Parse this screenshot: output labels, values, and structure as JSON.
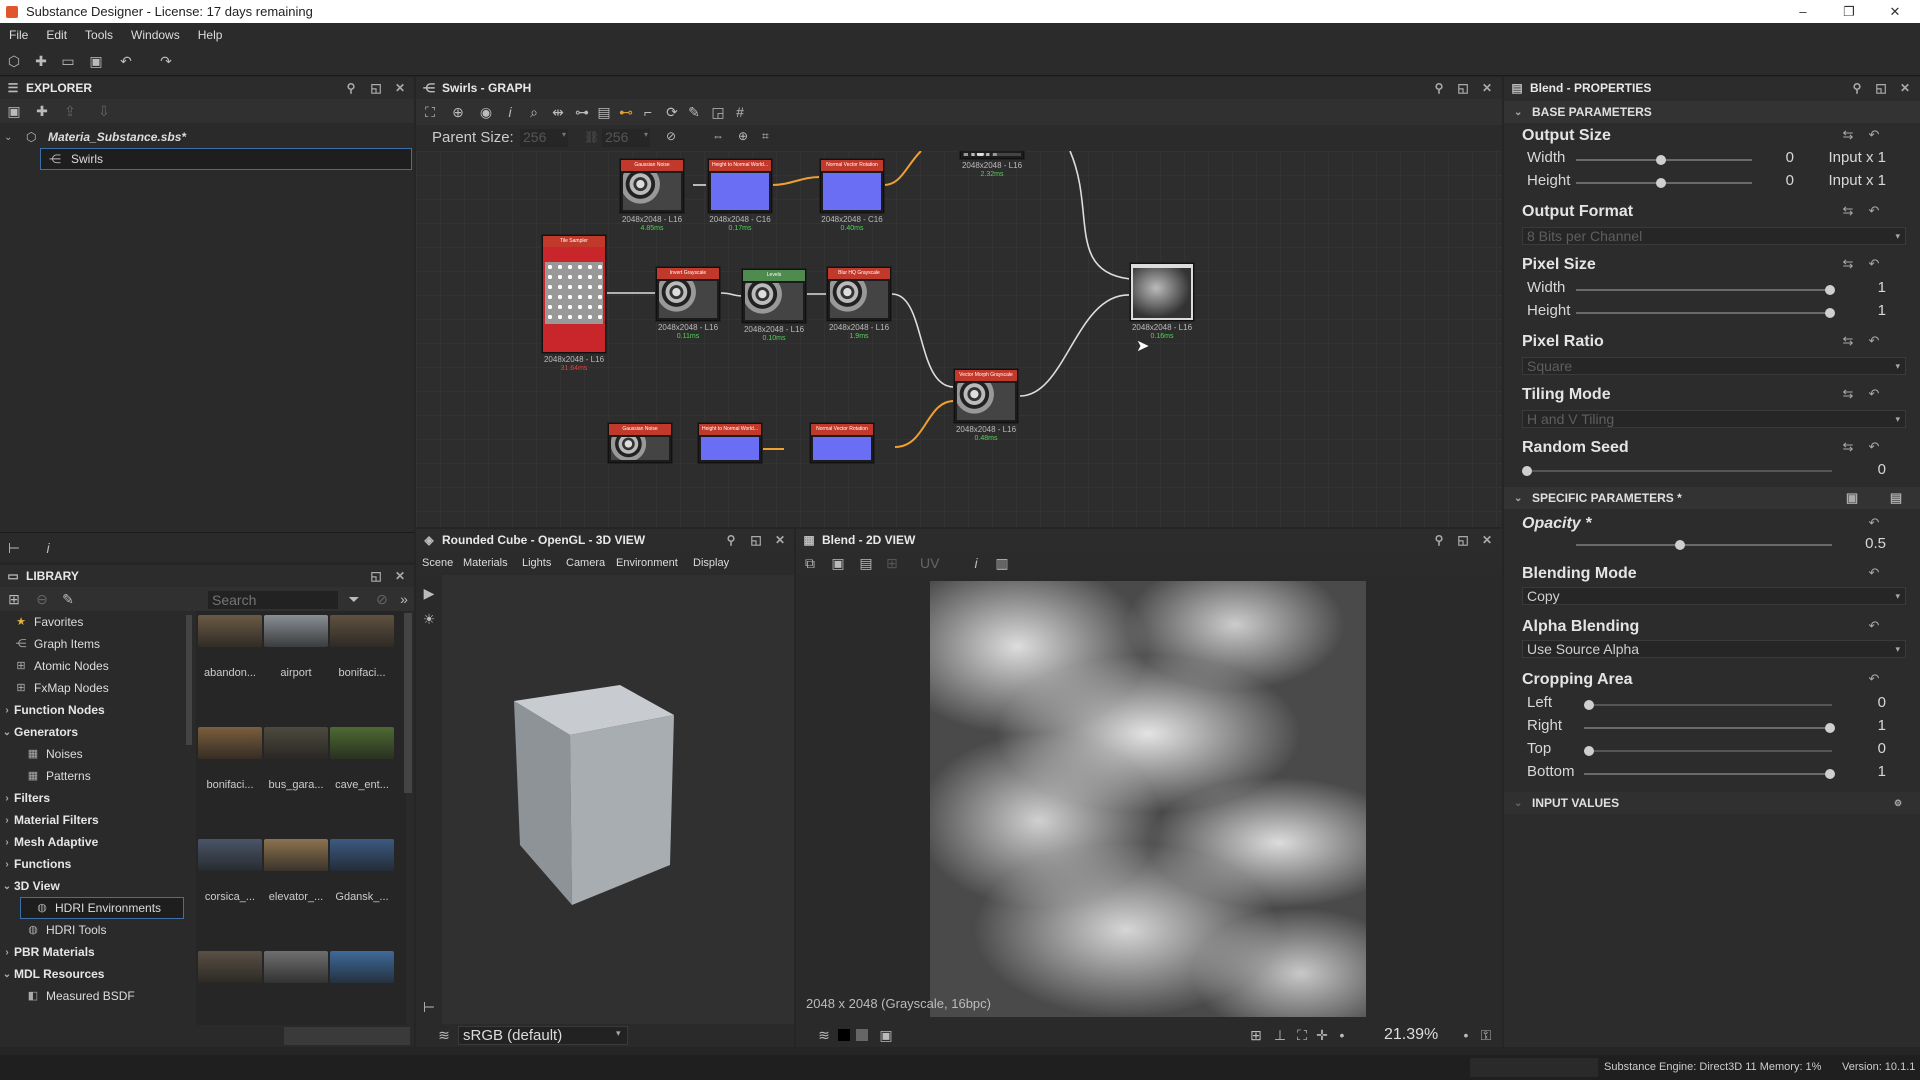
{
  "window": {
    "title": "Substance Designer - License: 17 days remaining",
    "minimize": "–",
    "maximize": "❐",
    "close": "✕"
  },
  "menu": [
    "File",
    "Edit",
    "Tools",
    "Windows",
    "Help"
  ],
  "explorer": {
    "title": "EXPLORER",
    "package": "Materia_Substance.sbs*",
    "graph_item": "Swirls"
  },
  "library": {
    "title": "LIBRARY",
    "search_placeholder": "Search",
    "categories": [
      {
        "label": "Favorites",
        "bold": false,
        "arrow": "",
        "icon": "star-icon"
      },
      {
        "label": "Graph Items",
        "bold": false,
        "arrow": "",
        "icon": "graph-items-icon"
      },
      {
        "label": "Atomic Nodes",
        "bold": false,
        "arrow": "",
        "icon": "atomic-nodes-icon"
      },
      {
        "label": "FxMap Nodes",
        "bold": false,
        "arrow": "",
        "icon": "fxmap-icon"
      },
      {
        "label": "Function Nodes",
        "bold": true,
        "arrow": "›",
        "icon": ""
      },
      {
        "label": "Generators",
        "bold": true,
        "arrow": "⌄",
        "icon": ""
      },
      {
        "label": "Noises",
        "bold": false,
        "arrow": "",
        "icon": "noises-icon",
        "indent": true
      },
      {
        "label": "Patterns",
        "bold": false,
        "arrow": "",
        "icon": "patterns-icon",
        "indent": true
      },
      {
        "label": "Filters",
        "bold": true,
        "arrow": "›",
        "icon": ""
      },
      {
        "label": "Material Filters",
        "bold": true,
        "arrow": "›",
        "icon": ""
      },
      {
        "label": "Mesh Adaptive",
        "bold": true,
        "arrow": "›",
        "icon": ""
      },
      {
        "label": "Functions",
        "bold": true,
        "arrow": "›",
        "icon": ""
      },
      {
        "label": "3D View",
        "bold": true,
        "arrow": "⌄",
        "icon": ""
      },
      {
        "label": "HDRI Environments",
        "bold": false,
        "arrow": "",
        "icon": "hdri-icon",
        "indent": true,
        "selected": true
      },
      {
        "label": "HDRI Tools",
        "bold": false,
        "arrow": "",
        "icon": "hdri-tools-icon",
        "indent": true
      },
      {
        "label": "PBR Materials",
        "bold": true,
        "arrow": "›",
        "icon": ""
      },
      {
        "label": "MDL Resources",
        "bold": true,
        "arrow": "⌄",
        "icon": ""
      },
      {
        "label": "Measured BSDF",
        "bold": false,
        "arrow": "",
        "icon": "bsdf-icon",
        "indent": true
      }
    ],
    "thumbnails": [
      {
        "label": "abandon...",
        "color": "#6b5a44"
      },
      {
        "label": "airport",
        "color": "#8a8f94"
      },
      {
        "label": "bonifaci...",
        "color": "#5f5240"
      },
      {
        "label": "bonifaci...",
        "color": "#7a5e3c"
      },
      {
        "label": "bus_gara...",
        "color": "#4d4a3e"
      },
      {
        "label": "cave_ent...",
        "color": "#4e6a32"
      },
      {
        "label": "corsica_...",
        "color": "#4a5568"
      },
      {
        "label": "elevator_...",
        "color": "#8c7350"
      },
      {
        "label": "Gdansk_...",
        "color": "#3c5a82"
      },
      {
        "label": "",
        "color": "#5a5044"
      },
      {
        "label": "",
        "color": "#6f6f70"
      },
      {
        "label": "",
        "color": "#3f6a9a"
      }
    ]
  },
  "graph": {
    "title": "Swirls - GRAPH",
    "parent_size_label": "Parent Size:",
    "parent_size_w": "256",
    "parent_size_h": "256",
    "nodes": [
      {
        "name": "Gaussian Noise",
        "label": "2048x2048 - L16",
        "time": "4.85ms",
        "head": "#c0392b",
        "type": "gray"
      },
      {
        "name": "Height to Normal World...",
        "label": "2048x2048 - C16",
        "time": "0.17ms",
        "head": "#c0392b",
        "type": "blue"
      },
      {
        "name": "Normal Vector Rotation",
        "label": "2048x2048 - C16",
        "time": "0.40ms",
        "head": "#c0392b",
        "type": "blue"
      },
      {
        "name": "Tile Sampler",
        "label": "2048x2048 - L16",
        "time": "31.64ms",
        "head": "#c0392b",
        "type": "tile"
      },
      {
        "name": "Invert Grayscale",
        "label": "2048x2048 - L16",
        "time": "0.11ms",
        "head": "#c0392b",
        "type": "gray"
      },
      {
        "name": "Levels",
        "label": "2048x2048 - L16",
        "time": "0.10ms",
        "head": "#4f8a4f",
        "type": "gray"
      },
      {
        "name": "Blur HQ Grayscale",
        "label": "2048x2048 - L16",
        "time": "1.9ms",
        "head": "#c0392b",
        "type": "gray"
      },
      {
        "name": "Vector Morph Grayscale",
        "label": "2048x2048 - L16",
        "time": "0.48ms",
        "head": "#c0392b",
        "type": "gray"
      },
      {
        "name": "Blend",
        "label": "2048x2048 - L16",
        "time": "0.16ms",
        "head": "#888",
        "type": "blend"
      },
      {
        "name": "",
        "label": "2048x2048 - L16",
        "time": "2.32ms",
        "head": "#c0392b",
        "type": "gray"
      },
      {
        "name": "Gaussian Noise",
        "label": "",
        "time": "",
        "head": "#c0392b",
        "type": "gray"
      },
      {
        "name": "Height to Normal World...",
        "label": "",
        "time": "",
        "head": "#c0392b",
        "type": "blue"
      },
      {
        "name": "Normal Vector Rotation",
        "label": "",
        "time": "",
        "head": "#c0392b",
        "type": "blue"
      }
    ]
  },
  "view3d": {
    "title": "Rounded Cube - OpenGL - 3D VIEW",
    "menu": [
      "Scene",
      "Materials",
      "Lights",
      "Camera",
      "Environment",
      "Display"
    ],
    "colorspace": "sRGB (default)"
  },
  "view2d": {
    "title": "Blend - 2D VIEW",
    "uv_label": "UV",
    "info": "2048 x 2048 (Grayscale, 16bpc)",
    "zoom": "21.39%"
  },
  "properties": {
    "title": "Blend - PROPERTIES",
    "base_section": "BASE PARAMETERS",
    "output_size": {
      "title": "Output Size",
      "width_label": "Width",
      "width_val": "0",
      "width_mode": "Input x 1",
      "height_label": "Height",
      "height_val": "0",
      "height_mode": "Input x 1"
    },
    "output_format": {
      "title": "Output Format",
      "value": "8 Bits per Channel"
    },
    "pixel_size": {
      "title": "Pixel Size",
      "width_label": "Width",
      "width_val": "1",
      "height_label": "Height",
      "height_val": "1"
    },
    "pixel_ratio": {
      "title": "Pixel Ratio",
      "value": "Square"
    },
    "tiling_mode": {
      "title": "Tiling Mode",
      "value": "H and V Tiling"
    },
    "random_seed": {
      "title": "Random Seed",
      "value": "0"
    },
    "specific_section": "SPECIFIC PARAMETERS *",
    "opacity": {
      "title": "Opacity *",
      "value": "0.5"
    },
    "blending_mode": {
      "title": "Blending Mode",
      "value": "Copy"
    },
    "alpha_blending": {
      "title": "Alpha Blending",
      "value": "Use Source Alpha"
    },
    "cropping": {
      "title": "Cropping Area",
      "left_label": "Left",
      "left_val": "0",
      "right_label": "Right",
      "right_val": "1",
      "top_label": "Top",
      "top_val": "0",
      "bottom_label": "Bottom",
      "bottom_val": "1"
    },
    "input_section": "INPUT VALUES"
  },
  "status": {
    "engine": "Substance Engine: Direct3D 11 Memory: 1%",
    "version": "Version: 10.1.1"
  }
}
